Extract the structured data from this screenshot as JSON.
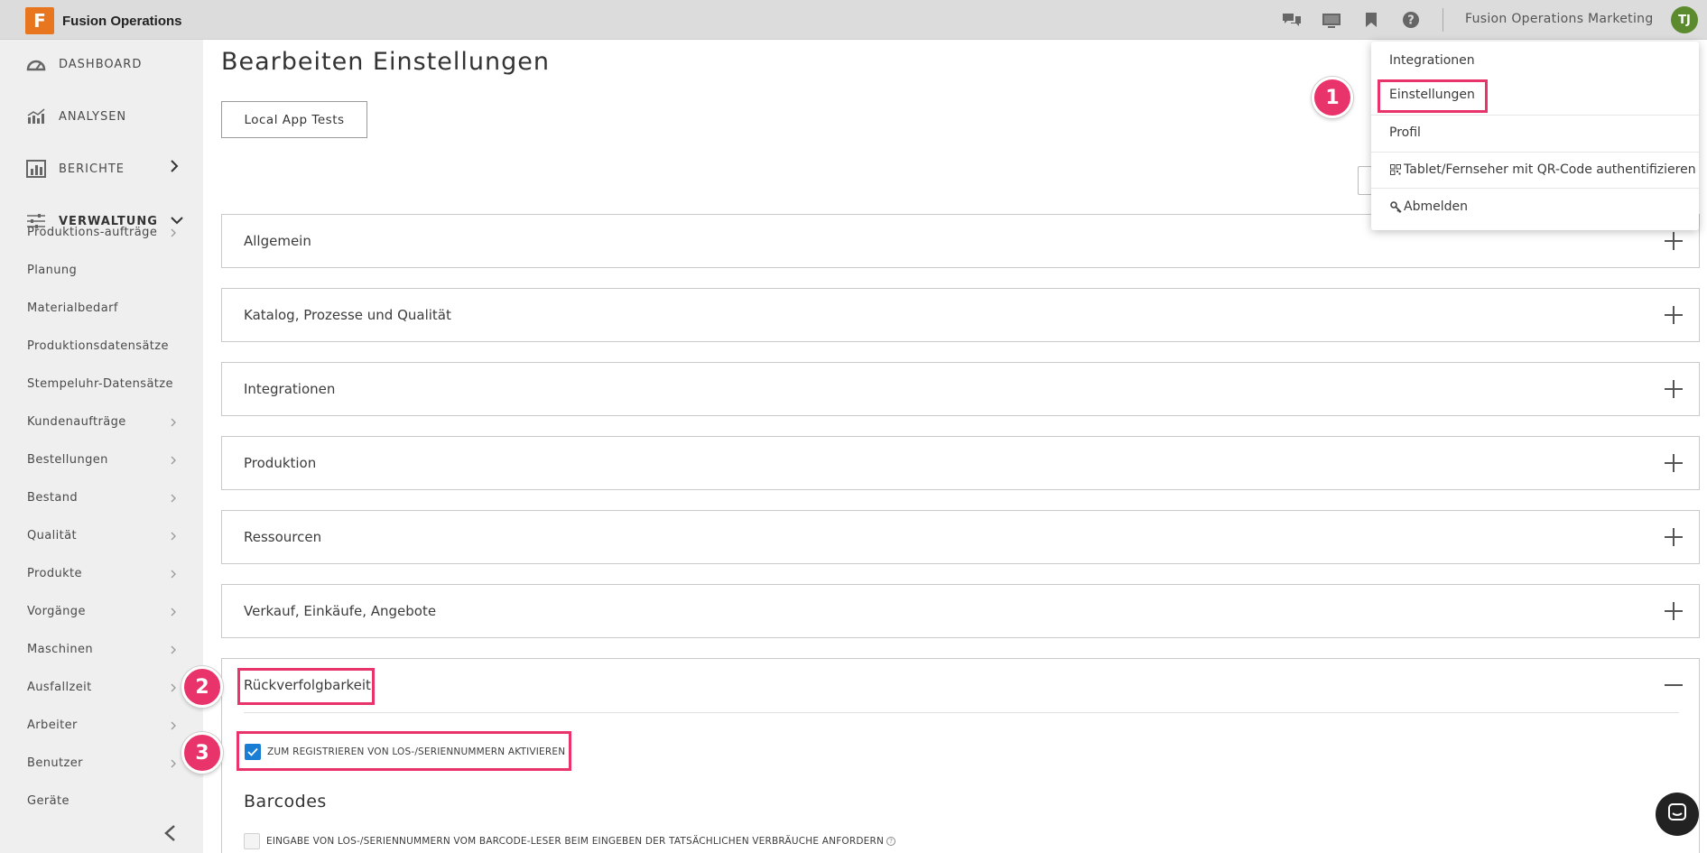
{
  "brand": {
    "logo_letter": "F",
    "name": "Fusion Operations"
  },
  "topbar": {
    "icons": [
      "chat-icon",
      "tv-icon",
      "bookmark-icon",
      "help-icon"
    ],
    "org_name": "Fusion Operations Marketing",
    "avatar_initials": "TJ"
  },
  "sidebar": {
    "main_items": [
      {
        "label": "DASHBOARD",
        "icon": "dashboard-gauge-icon"
      },
      {
        "label": "ANALYSEN",
        "icon": "analytics-chart-icon"
      },
      {
        "label": "BERICHTE",
        "icon": "reports-bar-icon"
      },
      {
        "label": "VERWALTUNG",
        "icon": "sliders-icon"
      }
    ],
    "sub_items": [
      {
        "label": "Produktions-aufträge",
        "has_chevron": true
      },
      {
        "label": "Planung",
        "has_chevron": false
      },
      {
        "label": "Materialbedarf",
        "has_chevron": false
      },
      {
        "label": "Produktionsdatensätze",
        "has_chevron": false
      },
      {
        "label": "Stempeluhr-Datensätze",
        "has_chevron": false
      },
      {
        "label": "Kundenaufträge",
        "has_chevron": true
      },
      {
        "label": "Bestellungen",
        "has_chevron": true
      },
      {
        "label": "Bestand",
        "has_chevron": true
      },
      {
        "label": "Qualität",
        "has_chevron": true
      },
      {
        "label": "Produkte",
        "has_chevron": true
      },
      {
        "label": "Vorgänge",
        "has_chevron": true
      },
      {
        "label": "Maschinen",
        "has_chevron": true
      },
      {
        "label": "Ausfallzeit",
        "has_chevron": true
      },
      {
        "label": "Arbeiter",
        "has_chevron": true
      },
      {
        "label": "Benutzer",
        "has_chevron": true
      },
      {
        "label": "Geräte",
        "has_chevron": false
      }
    ]
  },
  "main": {
    "title": "Bearbeiten Einstellungen",
    "app_button": "Local App Tests",
    "sections": [
      "Allgemein",
      "Katalog, Prozesse und Qualität",
      "Integrationen",
      "Produktion",
      "Ressourcen",
      "Verkauf, Einkäufe, Angebote"
    ],
    "open_section": {
      "title": "Rückverfolgbarkeit",
      "checkbox_enable": {
        "label": "ZUM REGISTRIEREN VON LOS-/SERIENNUMMERN AKTIVIEREN",
        "checked": true
      },
      "barcodes_heading": "Barcodes",
      "checkbox_barcode": {
        "label": "EINGABE VON LOS-/SERIENNUMMERN VOM BARCODE-LESER BEIM EINGEBEN DER TATSÄCHLICHEN VERBRÄUCHE ANFORDERN",
        "checked": false
      }
    }
  },
  "dropdown": {
    "items": [
      "Integrationen",
      "Einstellungen",
      "Profil",
      "Tablet/Fernseher mit QR-Code authentifizieren",
      "Abmelden"
    ]
  },
  "annotations": {
    "badge_1": "1",
    "badge_2": "2",
    "badge_3": "3",
    "highlight_color": "#e8336b"
  },
  "colors": {
    "accent": "#1a7fd4",
    "brand": "#e8761e",
    "avatar": "#5b8a2f"
  }
}
